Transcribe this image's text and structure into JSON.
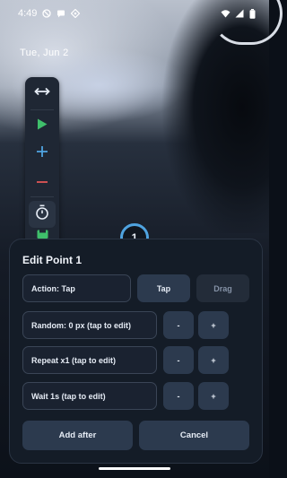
{
  "status_bar": {
    "time": "4:49",
    "icons_left": [
      "do-not-disturb-icon",
      "message-icon",
      "location-icon"
    ],
    "icons_right": [
      "wifi-icon",
      "signal-icon",
      "battery-icon"
    ]
  },
  "lockscreen": {
    "date": "Tue, Jun 2"
  },
  "toolbar": {
    "items": [
      "move-icon",
      "play-icon",
      "add-icon",
      "remove-icon",
      "timer-icon",
      "save-icon"
    ],
    "colors": {
      "play": "#3fbf6b",
      "add": "#4fa3e0",
      "remove": "#e05555",
      "save": "#3fbf6b"
    }
  },
  "point_marker": {
    "number": "1"
  },
  "edit_panel": {
    "title": "Edit Point 1",
    "action_label": "Action: Tap",
    "tap_button": "Tap",
    "drag_button": "Drag",
    "random_label": "Random: 0 px (tap to edit)",
    "repeat_label": "Repeat x1 (tap to edit)",
    "wait_label": "Wait 1s (tap to edit)",
    "minus": "-",
    "plus": "+",
    "add_after": "Add after",
    "cancel": "Cancel"
  }
}
